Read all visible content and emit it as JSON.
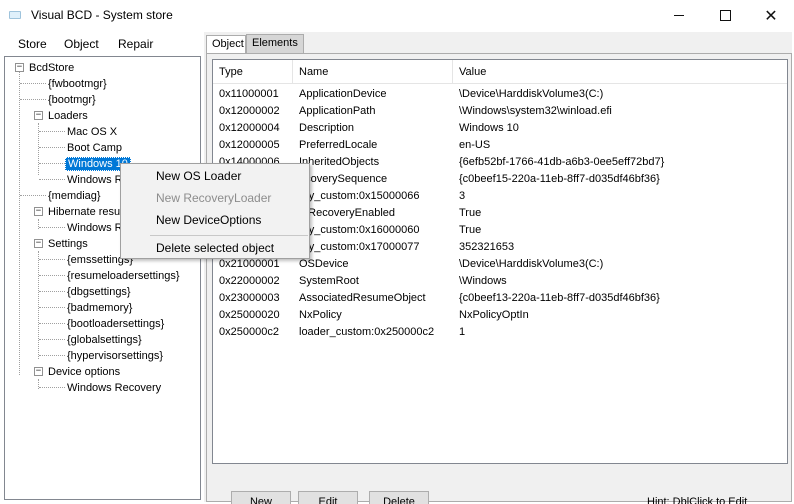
{
  "window": {
    "title": "Visual BCD - System store",
    "minimize_glyph": "",
    "maximize_glyph": "",
    "close_glyph": "✕"
  },
  "menu": [
    "Store",
    "Object",
    "Repair"
  ],
  "tree": {
    "root": "BcdStore",
    "items": [
      {
        "label": "{fwbootmgr}"
      },
      {
        "label": "{bootmgr}"
      },
      {
        "label": "Loaders"
      },
      {
        "label": "Mac OS X"
      },
      {
        "label": "Boot Camp"
      },
      {
        "label": "Windows 10"
      },
      {
        "label": "Windows R"
      },
      {
        "label": "{memdiag}"
      },
      {
        "label": "Hibernate resume"
      },
      {
        "label": "Windows R"
      },
      {
        "label": "Settings"
      },
      {
        "label": "{emssettings}"
      },
      {
        "label": "{resumeloadersettings}"
      },
      {
        "label": "{dbgsettings}"
      },
      {
        "label": "{badmemory}"
      },
      {
        "label": "{bootloadersettings}"
      },
      {
        "label": "{globalsettings}"
      },
      {
        "label": "{hypervisorsettings}"
      },
      {
        "label": "Device options"
      },
      {
        "label": "Windows Recovery"
      }
    ],
    "expand_glyph": "−"
  },
  "tabs": {
    "object": "Object",
    "elements": "Elements"
  },
  "grid": {
    "headers": [
      "Type",
      "Name",
      "Value"
    ],
    "rows": [
      {
        "type": "0x11000001",
        "name": "ApplicationDevice",
        "value": "\\Device\\HarddiskVolume3(C:)"
      },
      {
        "type": "0x12000002",
        "name": "ApplicationPath",
        "value": "\\Windows\\system32\\winload.efi"
      },
      {
        "type": "0x12000004",
        "name": "Description",
        "value": "Windows 10"
      },
      {
        "type": "0x12000005",
        "name": "PreferredLocale",
        "value": "en-US"
      },
      {
        "type": "0x14000006",
        "name": "InheritedObjects",
        "value": "{6efb52bf-1766-41db-a6b3-0ee5eff72bd7}"
      },
      {
        "type": "",
        "name": "ecoverySequence",
        "value": "{c0beef15-220a-11eb-8ff7-d035df46bf36}"
      },
      {
        "type": "",
        "name": "ary_custom:0x15000066",
        "value": "3"
      },
      {
        "type": "",
        "name": "toRecoveryEnabled",
        "value": "True"
      },
      {
        "type": "",
        "name": "ary_custom:0x16000060",
        "value": "True"
      },
      {
        "type": "",
        "name": "ary_custom:0x17000077",
        "value": "352321653"
      },
      {
        "type": "0x21000001",
        "name": "OSDevice",
        "value": "\\Device\\HarddiskVolume3(C:)"
      },
      {
        "type": "0x22000002",
        "name": "SystemRoot",
        "value": "\\Windows"
      },
      {
        "type": "0x23000003",
        "name": "AssociatedResumeObject",
        "value": "{c0beef13-220a-11eb-8ff7-d035df46bf36}"
      },
      {
        "type": "0x25000020",
        "name": "NxPolicy",
        "value": "NxPolicyOptIn"
      },
      {
        "type": "0x250000c2",
        "name": "loader_custom:0x250000c2",
        "value": "1"
      }
    ]
  },
  "buttons": {
    "new": "New",
    "edit": "Edit",
    "delete": "Delete"
  },
  "hint": "Hint: DblClick to Edit",
  "context_menu": {
    "items": [
      {
        "label": "New OS Loader",
        "enabled": true
      },
      {
        "label": "New RecoveryLoader",
        "enabled": false
      },
      {
        "label": "New DeviceOptions",
        "enabled": true
      },
      {
        "label": "Delete selected object",
        "enabled": true
      }
    ]
  },
  "colors": {
    "selection": "#0078d7",
    "panel_bg": "#f0f0f0"
  }
}
